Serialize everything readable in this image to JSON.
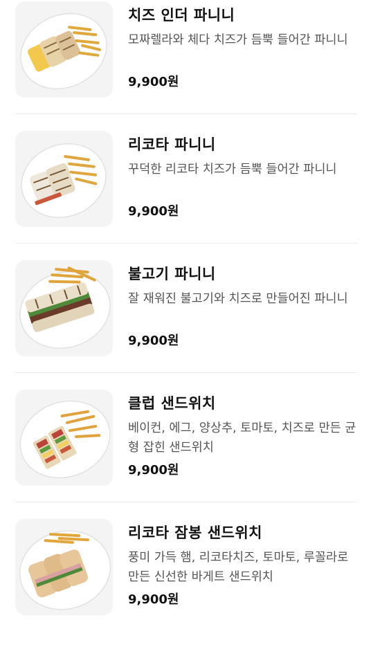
{
  "menu": {
    "items": [
      {
        "name": "치즈 인더 파니니",
        "description": "모짜렐라와 체다 치즈가 듬뿍 들어간 파니니",
        "price": "9,900원",
        "image_icon": "panini-food-image"
      },
      {
        "name": "리코타 파니니",
        "description": "꾸덕한 리코타 치즈가 듬뿍 들어간 파니니",
        "price": "9,900원",
        "image_icon": "panini-food-image"
      },
      {
        "name": "불고기 파니니",
        "description": "잘 재워진 불고기와 치즈로 만들어진 파니니",
        "price": "9,900원",
        "image_icon": "panini-food-image"
      },
      {
        "name": "클럽 샌드위치",
        "description": "베이컨, 에그, 양상추, 토마토, 치즈로 만든 균형 잡힌 샌드위치",
        "price": "9,900원",
        "image_icon": "sandwich-food-image"
      },
      {
        "name": "리코타 잠봉 샌드위치",
        "description": "풍미 가득 햄, 리코타치즈, 토마토, 루꼴라로 만든 신선한 바게트 샌드위치",
        "price": "9,900원",
        "image_icon": "sandwich-food-image"
      }
    ]
  },
  "colors": {
    "background": "#ffffff",
    "title": "#111111",
    "description": "#555555",
    "divider": "#ececec",
    "thumb_bg": "#f4f4f4"
  }
}
